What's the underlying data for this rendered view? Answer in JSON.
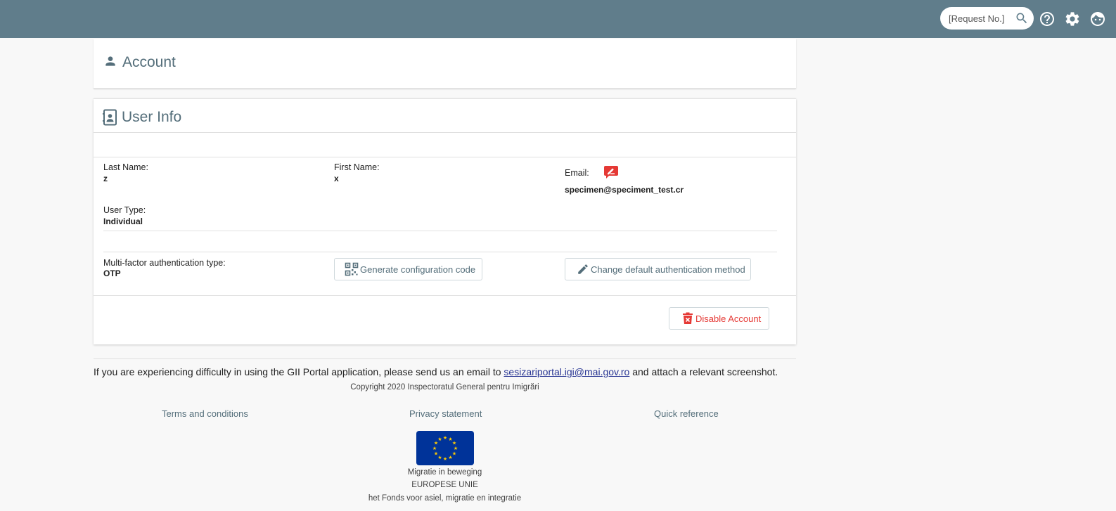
{
  "header": {
    "search": {
      "placeholder": "[Request No.]",
      "value": ""
    },
    "icons": [
      "search-icon",
      "help-icon",
      "gear-icon",
      "account-face-icon"
    ],
    "background": "#607d8b"
  },
  "account_card": {
    "title": "Account",
    "icon": "person-icon"
  },
  "user_info": {
    "title": "User Info",
    "icon": "contact-card-icon",
    "last_name_label": "Last Name:",
    "last_name": "z",
    "first_name_label": "First Name:",
    "first_name": "x",
    "email_label": "Email:",
    "email": "specimen@speciment_test.cr",
    "email_edit_icon": "edit-message-icon",
    "user_type_label": "User Type:",
    "user_type": "Individual",
    "mfa_label": "Multi-factor authentication type:",
    "mfa_value": "OTP",
    "generate_code_button": "Generate configuration code",
    "change_method_button": "Change default authentication method",
    "disable_account_button": "Disable Account"
  },
  "footer": {
    "help_prefix": "If you are experiencing difficulty in using the GII Portal application, please send us an email to",
    "help_email": "sesizariportal.igi@mai.gov.ro",
    "help_suffix": "and attach a relevant screenshot.",
    "copyright": "Copyright 2020 Inspectoratul General pentru Imigrări",
    "links": [
      "Terms and conditions",
      "Privacy statement",
      "Quick reference"
    ],
    "eu_lines": [
      "Migratie in beweging",
      "EUROPESE UNIE",
      "het Fonds voor asiel, migratie en integratie"
    ]
  },
  "colors": {
    "accent": "#546e7a",
    "danger": "#e53935",
    "eu_blue": "#003399",
    "eu_gold": "#ffcc00"
  }
}
